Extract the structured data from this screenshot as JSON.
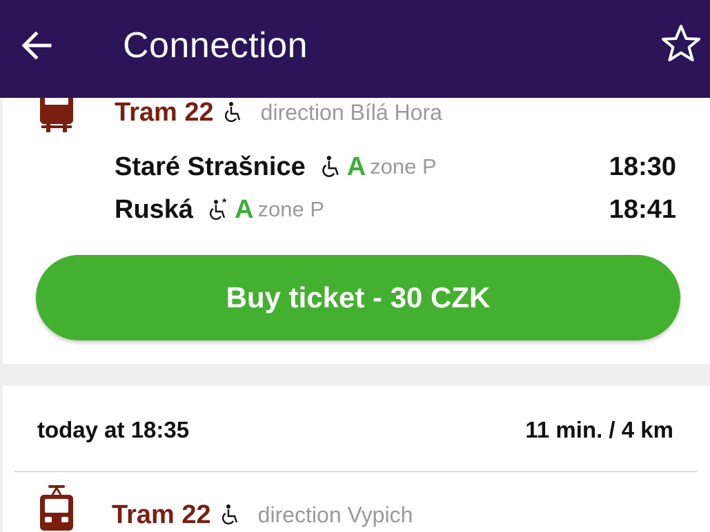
{
  "header": {
    "title": "Connection",
    "back_icon": "arrow-left-icon",
    "favorite_icon": "star-outline-icon"
  },
  "colors": {
    "app_bar": "#2b1457",
    "line_name": "#7a1f10",
    "zone_letter": "#3dae37",
    "buy_button": "#43b12f",
    "muted_text": "#9a9a9a"
  },
  "segment": {
    "line_icon": "tram-icon",
    "line_name": "Tram 22",
    "accessibility_icon": "wheelchair-icon",
    "direction": "direction Bílá Hora",
    "stops": [
      {
        "name": "Staré Strašnice",
        "accessibility_icon": "wheelchair-icon",
        "zone_letter": "A",
        "zone": "zone P",
        "time": "18:30"
      },
      {
        "name": "Ruská",
        "accessibility_icon": "wheelchair-partial-icon",
        "zone_letter": "A",
        "zone": "zone P",
        "time": "18:41"
      }
    ],
    "buy_button_label": "Buy ticket - 30 CZK"
  },
  "next_trip": {
    "when": "today at 18:35",
    "summary": "11 min. / 4 km",
    "line_icon": "tram-icon",
    "line_name": "Tram 22",
    "accessibility_icon": "wheelchair-icon",
    "direction": "direction Vypich"
  }
}
